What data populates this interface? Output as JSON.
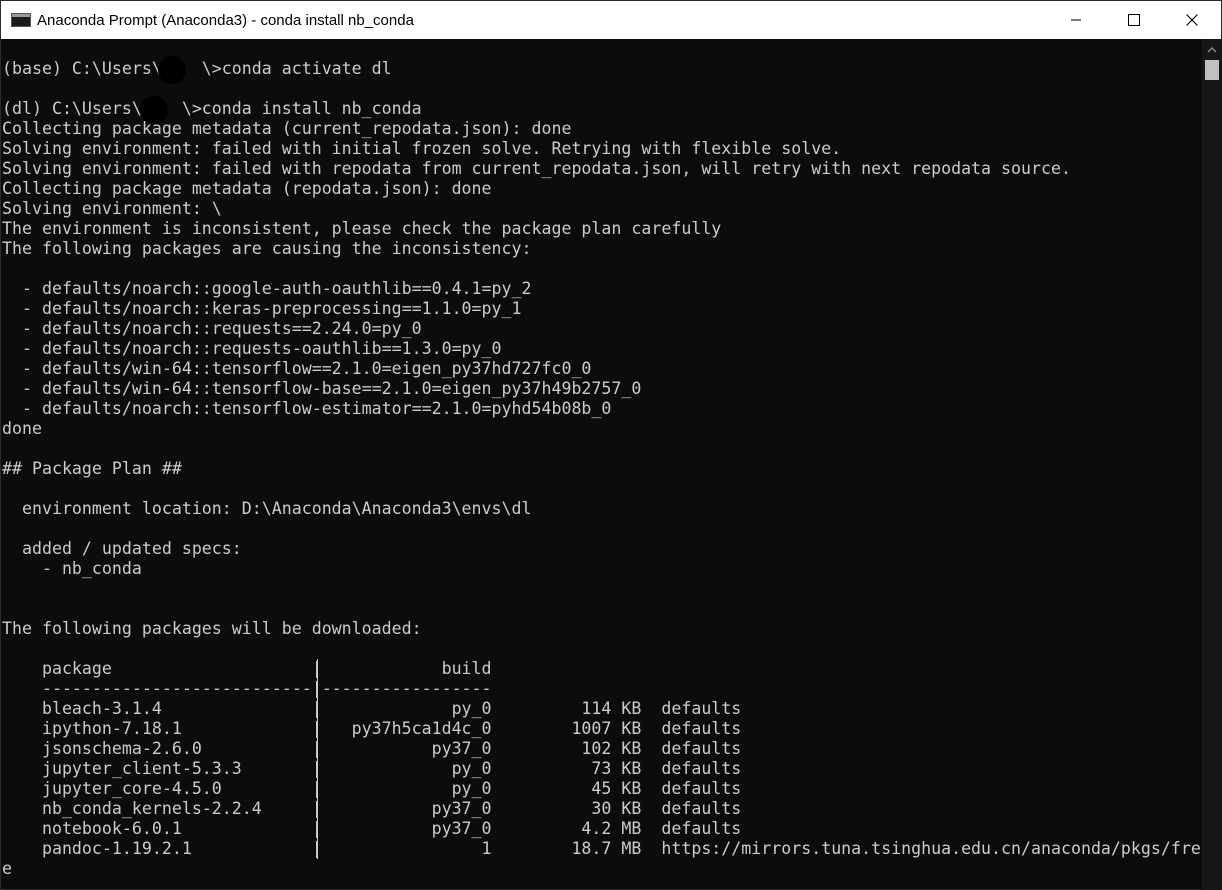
{
  "window": {
    "title": "Anaconda Prompt (Anaconda3) - conda  install nb_conda"
  },
  "icons": {
    "app": "console-window-icon",
    "minimize": "minimize-icon",
    "maximize": "maximize-icon",
    "close": "close-icon",
    "scroll_up": "chevron-up-icon"
  },
  "console": {
    "lines": [
      "(base) C:\\Users\\    \\>conda activate dl",
      "",
      "(dl) C:\\Users\\    \\>conda install nb_conda",
      "Collecting package metadata (current_repodata.json): done",
      "Solving environment: failed with initial frozen solve. Retrying with flexible solve.",
      "Solving environment: failed with repodata from current_repodata.json, will retry with next repodata source.",
      "Collecting package metadata (repodata.json): done",
      "Solving environment: \\",
      "The environment is inconsistent, please check the package plan carefully",
      "The following packages are causing the inconsistency:",
      "",
      "  - defaults/noarch::google-auth-oauthlib==0.4.1=py_2",
      "  - defaults/noarch::keras-preprocessing==1.1.0=py_1",
      "  - defaults/noarch::requests==2.24.0=py_0",
      "  - defaults/noarch::requests-oauthlib==1.3.0=py_0",
      "  - defaults/win-64::tensorflow==2.1.0=eigen_py37hd727fc0_0",
      "  - defaults/win-64::tensorflow-base==2.1.0=eigen_py37h49b2757_0",
      "  - defaults/noarch::tensorflow-estimator==2.1.0=pyhd54b08b_0",
      "done",
      "",
      "## Package Plan ##",
      "",
      "  environment location: D:\\Anaconda\\Anaconda3\\envs\\dl",
      "",
      "  added / updated specs:",
      "    - nb_conda",
      "",
      "",
      "The following packages will be downloaded:",
      "",
      "    package                    |            build",
      "    ---------------------------|-----------------",
      "    bleach-3.1.4               |             py_0         114 KB  defaults",
      "    ipython-7.18.1             |   py37h5ca1d4c_0        1007 KB  defaults",
      "    jsonschema-2.6.0           |           py37_0         102 KB  defaults",
      "    jupyter_client-5.3.3       |             py_0          73 KB  defaults",
      "    jupyter_core-4.5.0         |             py_0          45 KB  defaults",
      "    nb_conda_kernels-2.2.4     |           py37_0          30 KB  defaults",
      "    notebook-6.0.1             |           py37_0         4.2 MB  defaults",
      "    pandoc-1.19.2.1            |                1        18.7 MB  https://mirrors.tuna.tsinghua.edu.cn/anaconda/pkgs/fre",
      "e"
    ]
  }
}
